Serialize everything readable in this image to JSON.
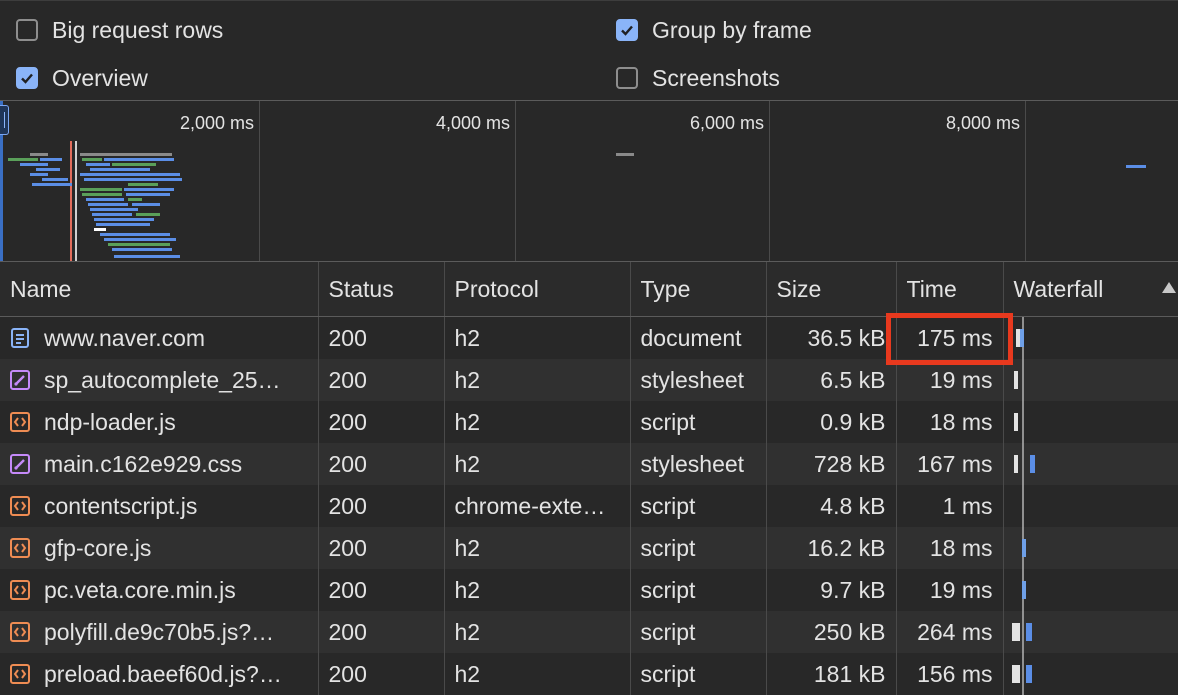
{
  "settings": {
    "big_request_rows": {
      "label": "Big request rows",
      "checked": false
    },
    "group_by_frame": {
      "label": "Group by frame",
      "checked": true
    },
    "overview": {
      "label": "Overview",
      "checked": true
    },
    "screenshots": {
      "label": "Screenshots",
      "checked": false
    }
  },
  "overview": {
    "ticks": [
      "2,000 ms",
      "4,000 ms",
      "6,000 ms",
      "8,000 ms"
    ]
  },
  "table": {
    "headers": {
      "name": "Name",
      "status": "Status",
      "protocol": "Protocol",
      "type": "Type",
      "size": "Size",
      "time": "Time",
      "waterfall": "Waterfall"
    },
    "rows": [
      {
        "name": "www.naver.com",
        "icon": "document-icon",
        "status": "200",
        "protocol": "h2",
        "type": "document",
        "size": "36.5 kB",
        "time": "175 ms"
      },
      {
        "name": "sp_autocomplete_25…",
        "icon": "stylesheet-icon",
        "status": "200",
        "protocol": "h2",
        "type": "stylesheet",
        "size": "6.5 kB",
        "time": "19 ms"
      },
      {
        "name": "ndp-loader.js",
        "icon": "script-icon",
        "status": "200",
        "protocol": "h2",
        "type": "script",
        "size": "0.9 kB",
        "time": "18 ms"
      },
      {
        "name": "main.c162e929.css",
        "icon": "stylesheet-icon",
        "status": "200",
        "protocol": "h2",
        "type": "stylesheet",
        "size": "728 kB",
        "time": "167 ms"
      },
      {
        "name": "contentscript.js",
        "icon": "script-icon",
        "status": "200",
        "protocol": "chrome-exte…",
        "type": "script",
        "size": "4.8 kB",
        "time": "1 ms"
      },
      {
        "name": "gfp-core.js",
        "icon": "script-icon",
        "status": "200",
        "protocol": "h2",
        "type": "script",
        "size": "16.2 kB",
        "time": "18 ms"
      },
      {
        "name": "pc.veta.core.min.js",
        "icon": "script-icon",
        "status": "200",
        "protocol": "h2",
        "type": "script",
        "size": "9.7 kB",
        "time": "19 ms"
      },
      {
        "name": "polyfill.de9c70b5.js?…",
        "icon": "script-icon",
        "status": "200",
        "protocol": "h2",
        "type": "script",
        "size": "250 kB",
        "time": "264 ms"
      },
      {
        "name": "preload.baeef60d.js?…",
        "icon": "script-icon",
        "status": "200",
        "protocol": "h2",
        "type": "script",
        "size": "181 kB",
        "time": "156 ms"
      }
    ]
  },
  "highlighted_cell": "175 ms",
  "colors": {
    "accent": "#8ab4f8",
    "highlight": "#e8391e",
    "document_icon": "#8ab4f8",
    "stylesheet_icon": "#c58af9",
    "script_icon": "#ee8c53"
  }
}
